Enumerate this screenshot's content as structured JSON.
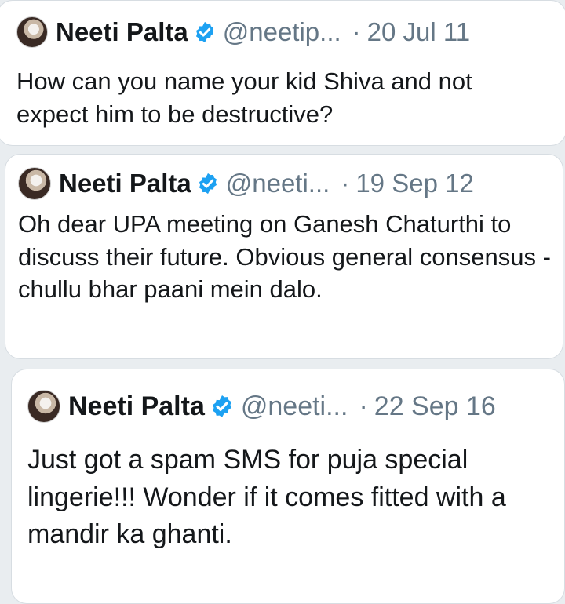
{
  "tweets": [
    {
      "name": "Neeti Palta",
      "handle": "@neetip...",
      "dot": "·",
      "date": "20 Jul 11",
      "text": "How can you name your kid Shiva and not expect him to be destructive?"
    },
    {
      "name": "Neeti Palta",
      "handle": "@neeti...",
      "dot": "·",
      "date": "19 Sep 12",
      "text": "Oh dear UPA meeting on Ganesh Chaturthi to discuss their future. Obvious general consensus - chullu bhar paani mein dalo."
    },
    {
      "name": "Neeti Palta",
      "handle": "@neeti...",
      "dot": "·",
      "date": "22 Sep 16",
      "text": "Just got a spam SMS for puja special lingerie!!! Wonder if it comes fitted with a mandir ka ghanti."
    }
  ],
  "colors": {
    "verified": "#1da1f2",
    "muted": "#657786",
    "text": "#14171a"
  },
  "icons": {
    "verified": "verified-badge-icon"
  }
}
